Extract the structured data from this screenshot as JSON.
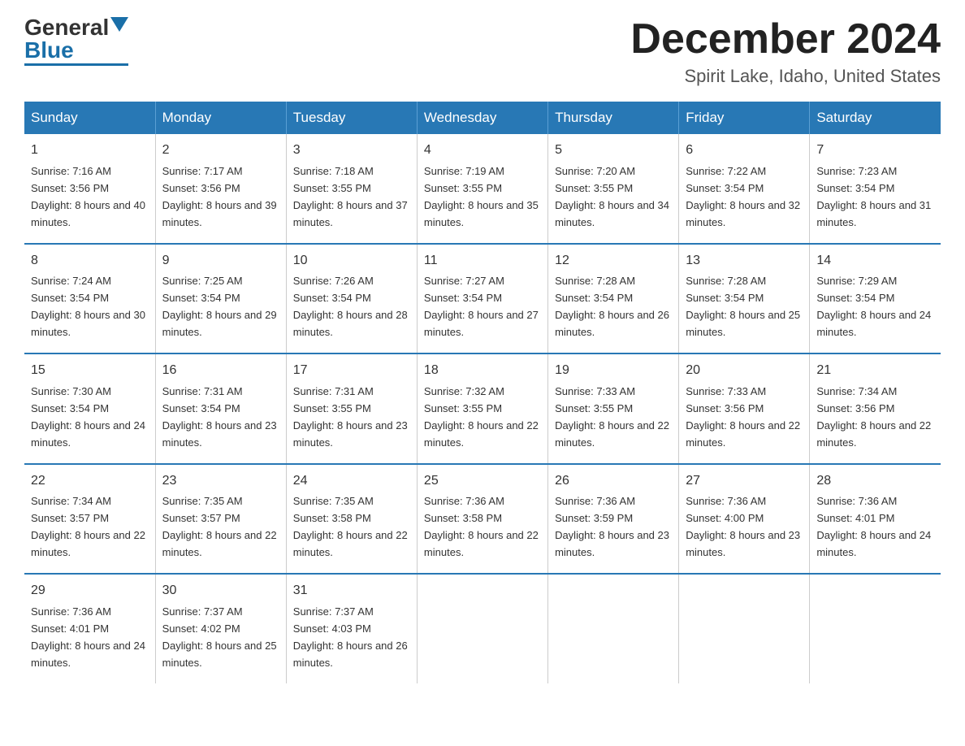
{
  "logo": {
    "general": "General",
    "blue": "Blue"
  },
  "header": {
    "month": "December 2024",
    "location": "Spirit Lake, Idaho, United States"
  },
  "days_of_week": [
    "Sunday",
    "Monday",
    "Tuesday",
    "Wednesday",
    "Thursday",
    "Friday",
    "Saturday"
  ],
  "weeks": [
    [
      {
        "day": "1",
        "sunrise": "7:16 AM",
        "sunset": "3:56 PM",
        "daylight": "8 hours and 40 minutes."
      },
      {
        "day": "2",
        "sunrise": "7:17 AM",
        "sunset": "3:56 PM",
        "daylight": "8 hours and 39 minutes."
      },
      {
        "day": "3",
        "sunrise": "7:18 AM",
        "sunset": "3:55 PM",
        "daylight": "8 hours and 37 minutes."
      },
      {
        "day": "4",
        "sunrise": "7:19 AM",
        "sunset": "3:55 PM",
        "daylight": "8 hours and 35 minutes."
      },
      {
        "day": "5",
        "sunrise": "7:20 AM",
        "sunset": "3:55 PM",
        "daylight": "8 hours and 34 minutes."
      },
      {
        "day": "6",
        "sunrise": "7:22 AM",
        "sunset": "3:54 PM",
        "daylight": "8 hours and 32 minutes."
      },
      {
        "day": "7",
        "sunrise": "7:23 AM",
        "sunset": "3:54 PM",
        "daylight": "8 hours and 31 minutes."
      }
    ],
    [
      {
        "day": "8",
        "sunrise": "7:24 AM",
        "sunset": "3:54 PM",
        "daylight": "8 hours and 30 minutes."
      },
      {
        "day": "9",
        "sunrise": "7:25 AM",
        "sunset": "3:54 PM",
        "daylight": "8 hours and 29 minutes."
      },
      {
        "day": "10",
        "sunrise": "7:26 AM",
        "sunset": "3:54 PM",
        "daylight": "8 hours and 28 minutes."
      },
      {
        "day": "11",
        "sunrise": "7:27 AM",
        "sunset": "3:54 PM",
        "daylight": "8 hours and 27 minutes."
      },
      {
        "day": "12",
        "sunrise": "7:28 AM",
        "sunset": "3:54 PM",
        "daylight": "8 hours and 26 minutes."
      },
      {
        "day": "13",
        "sunrise": "7:28 AM",
        "sunset": "3:54 PM",
        "daylight": "8 hours and 25 minutes."
      },
      {
        "day": "14",
        "sunrise": "7:29 AM",
        "sunset": "3:54 PM",
        "daylight": "8 hours and 24 minutes."
      }
    ],
    [
      {
        "day": "15",
        "sunrise": "7:30 AM",
        "sunset": "3:54 PM",
        "daylight": "8 hours and 24 minutes."
      },
      {
        "day": "16",
        "sunrise": "7:31 AM",
        "sunset": "3:54 PM",
        "daylight": "8 hours and 23 minutes."
      },
      {
        "day": "17",
        "sunrise": "7:31 AM",
        "sunset": "3:55 PM",
        "daylight": "8 hours and 23 minutes."
      },
      {
        "day": "18",
        "sunrise": "7:32 AM",
        "sunset": "3:55 PM",
        "daylight": "8 hours and 22 minutes."
      },
      {
        "day": "19",
        "sunrise": "7:33 AM",
        "sunset": "3:55 PM",
        "daylight": "8 hours and 22 minutes."
      },
      {
        "day": "20",
        "sunrise": "7:33 AM",
        "sunset": "3:56 PM",
        "daylight": "8 hours and 22 minutes."
      },
      {
        "day": "21",
        "sunrise": "7:34 AM",
        "sunset": "3:56 PM",
        "daylight": "8 hours and 22 minutes."
      }
    ],
    [
      {
        "day": "22",
        "sunrise": "7:34 AM",
        "sunset": "3:57 PM",
        "daylight": "8 hours and 22 minutes."
      },
      {
        "day": "23",
        "sunrise": "7:35 AM",
        "sunset": "3:57 PM",
        "daylight": "8 hours and 22 minutes."
      },
      {
        "day": "24",
        "sunrise": "7:35 AM",
        "sunset": "3:58 PM",
        "daylight": "8 hours and 22 minutes."
      },
      {
        "day": "25",
        "sunrise": "7:36 AM",
        "sunset": "3:58 PM",
        "daylight": "8 hours and 22 minutes."
      },
      {
        "day": "26",
        "sunrise": "7:36 AM",
        "sunset": "3:59 PM",
        "daylight": "8 hours and 23 minutes."
      },
      {
        "day": "27",
        "sunrise": "7:36 AM",
        "sunset": "4:00 PM",
        "daylight": "8 hours and 23 minutes."
      },
      {
        "day": "28",
        "sunrise": "7:36 AM",
        "sunset": "4:01 PM",
        "daylight": "8 hours and 24 minutes."
      }
    ],
    [
      {
        "day": "29",
        "sunrise": "7:36 AM",
        "sunset": "4:01 PM",
        "daylight": "8 hours and 24 minutes."
      },
      {
        "day": "30",
        "sunrise": "7:37 AM",
        "sunset": "4:02 PM",
        "daylight": "8 hours and 25 minutes."
      },
      {
        "day": "31",
        "sunrise": "7:37 AM",
        "sunset": "4:03 PM",
        "daylight": "8 hours and 26 minutes."
      },
      null,
      null,
      null,
      null
    ]
  ],
  "labels": {
    "sunrise": "Sunrise:",
    "sunset": "Sunset:",
    "daylight": "Daylight:"
  }
}
